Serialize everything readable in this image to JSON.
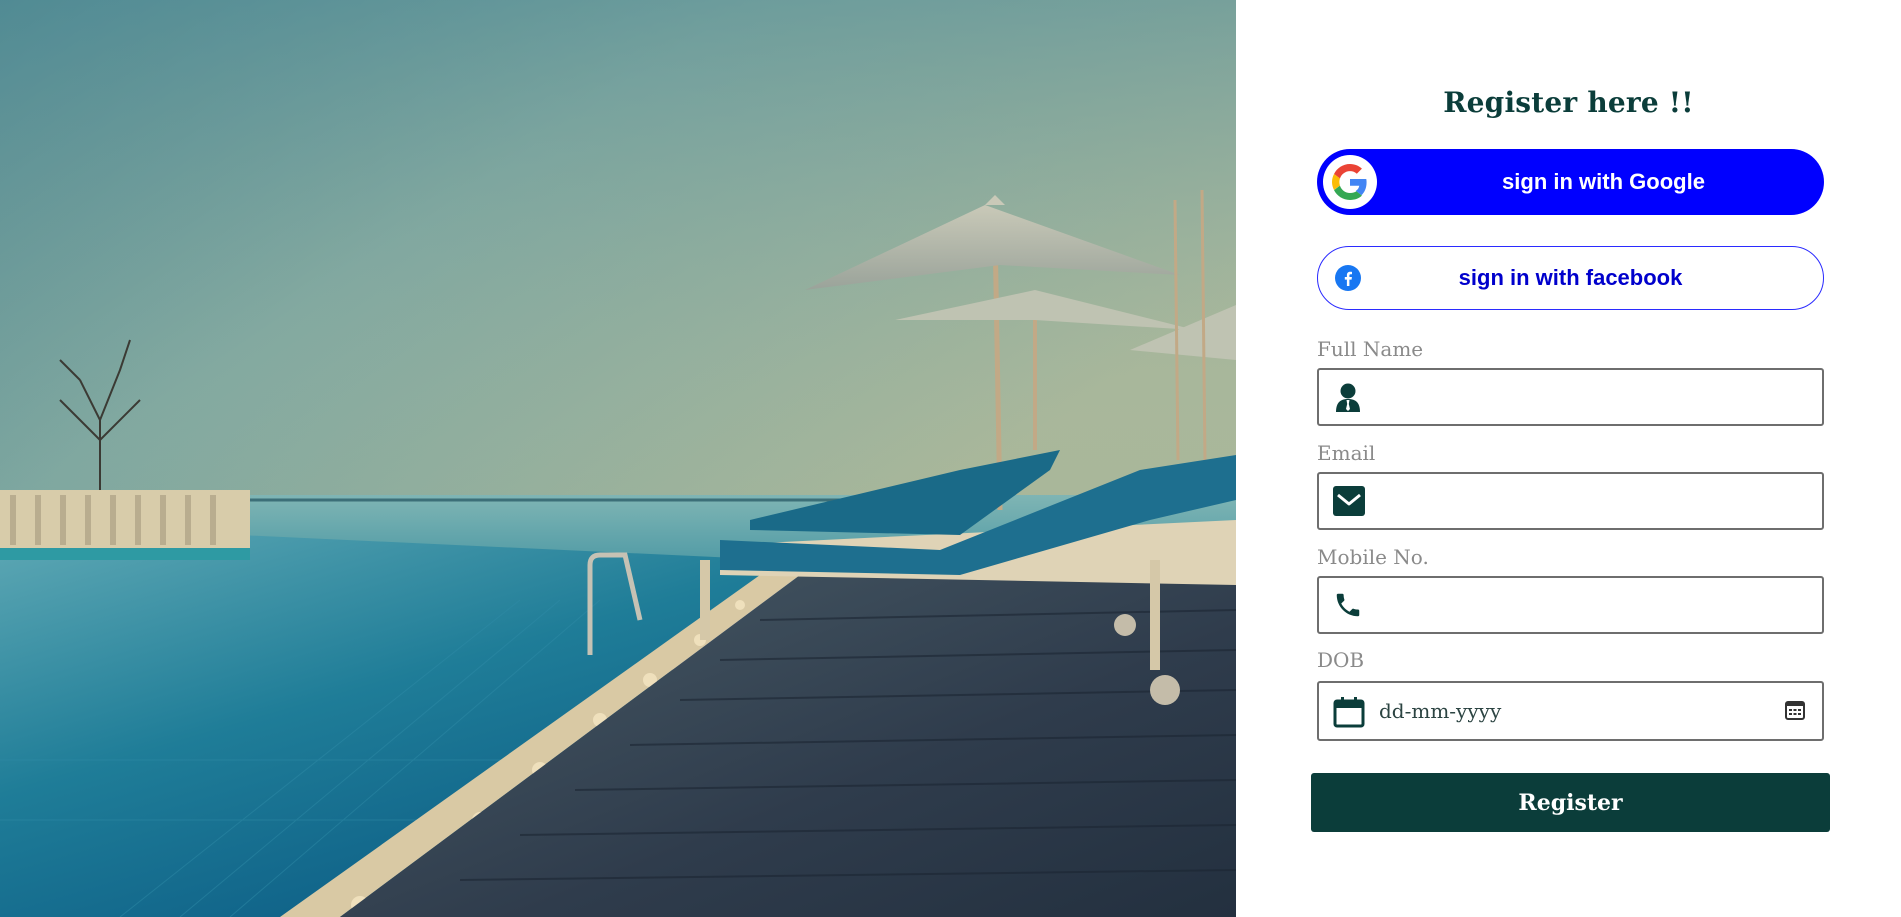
{
  "hero": {
    "description_icon": "pool-deck-photo"
  },
  "form": {
    "title": "Register here !!",
    "google_label": "sign in with Google",
    "facebook_label": "sign in with facebook",
    "fields": {
      "full_name": {
        "label": "Full Name",
        "value": "",
        "placeholder": "",
        "icon": "user-icon"
      },
      "email": {
        "label": "Email",
        "value": "",
        "placeholder": "",
        "icon": "mail-icon"
      },
      "mobile": {
        "label": "Mobile No.",
        "value": "",
        "placeholder": "",
        "icon": "phone-icon"
      },
      "dob": {
        "label": "DOB",
        "value": "",
        "placeholder": "dd-mm-yyyy",
        "icon": "calendar-icon"
      }
    },
    "register_label": "Register"
  },
  "colors": {
    "accent_dark": "#0b3d3a",
    "google_blue": "#0000ff",
    "facebook_border": "#2b2bff"
  }
}
